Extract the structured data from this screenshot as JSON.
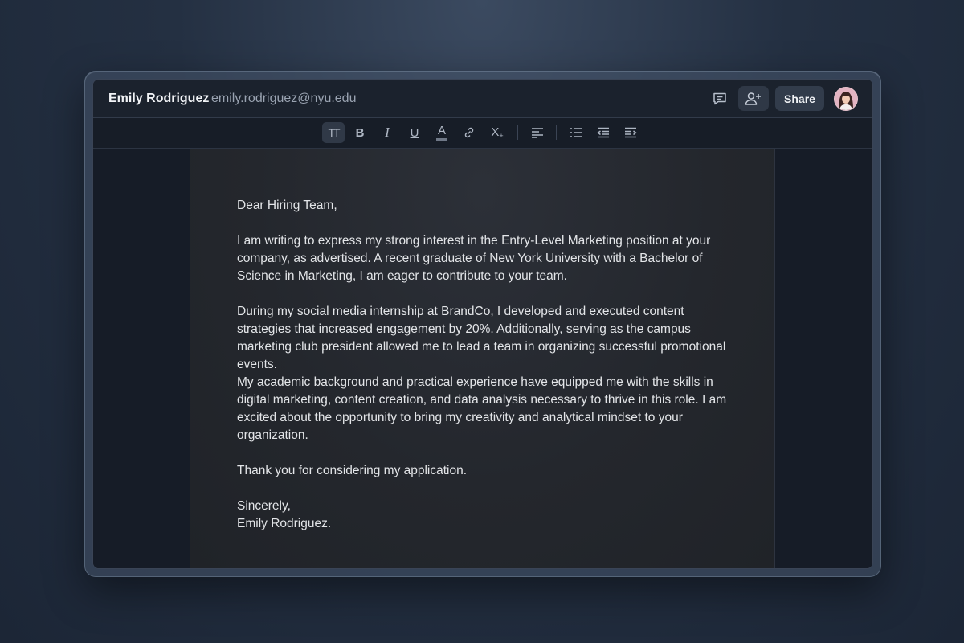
{
  "header": {
    "name": "Emily Rodriguez",
    "email": "emily.rodriguez@nyu.edu",
    "share_label": "Share"
  },
  "toolbar": {
    "items": [
      {
        "icon": "text-style-icon",
        "glyph": "TT",
        "active": true
      },
      {
        "icon": "bold-icon",
        "glyph": "B"
      },
      {
        "icon": "italic-icon",
        "glyph": "I"
      },
      {
        "icon": "underline-icon",
        "glyph": "U"
      },
      {
        "icon": "text-color-icon",
        "glyph": "A"
      },
      {
        "icon": "link-icon"
      },
      {
        "icon": "clear-format-icon",
        "glyph": "X"
      },
      {
        "icon": "align-left-icon"
      },
      {
        "icon": "numbered-list-icon"
      },
      {
        "icon": "outdent-icon"
      },
      {
        "icon": "indent-icon"
      }
    ]
  },
  "document": {
    "greeting": "Dear Hiring Team,",
    "para1": "I am writing to express my strong interest in the Entry-Level Marketing position at your company, as advertised. A recent graduate of New York University with a Bachelor of Science in Marketing, I am eager to contribute to your team.",
    "para2": "During my social media internship at BrandCo, I developed and executed content strategies that increased engagement by 20%. Additionally, serving as the campus marketing club president allowed me to lead a team in organizing successful promotional events.",
    "para3": "My academic background and practical experience have equipped me with the skills in digital marketing, content creation, and data analysis necessary to thrive in this role. I am excited about the opportunity to bring my creativity and analytical mindset to your organization.",
    "thanks": "Thank you for considering my application.",
    "closing": "Sincerely,",
    "signature": "Emily Rodriguez."
  }
}
